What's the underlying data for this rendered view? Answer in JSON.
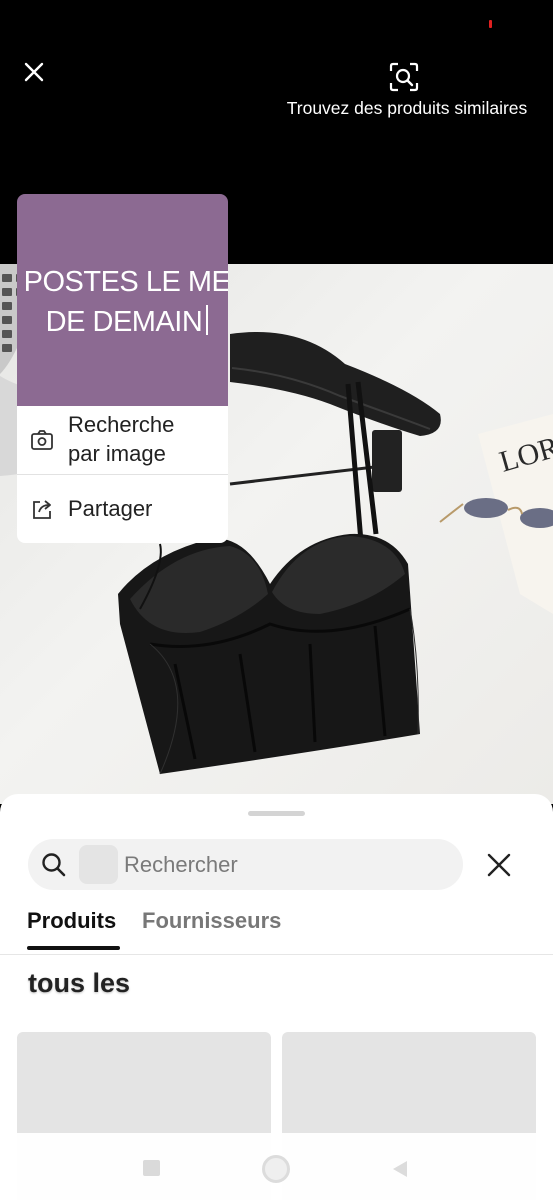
{
  "top_bar": {
    "close_icon": "close-icon",
    "similar_icon": "image-search-icon",
    "similar_label": "Trouvez des produits similaires"
  },
  "photo": {
    "description_icon": "product-photo",
    "book_text": "LOR"
  },
  "context_menu": {
    "preview_lines": [
      "POSTES LE ME",
      "DE DEMAIN"
    ],
    "preview_color": "#8c6a92",
    "items": [
      {
        "label_line1": "Recherche",
        "label_line2": "par image",
        "icon": "camera-icon"
      },
      {
        "label": "Partager",
        "icon": "share-icon"
      }
    ]
  },
  "sheet": {
    "search": {
      "placeholder": "Rechercher",
      "icon": "search-icon"
    },
    "close_icon": "close-icon",
    "tabs": [
      {
        "label": "Produits",
        "active": true
      },
      {
        "label": "Fournisseurs",
        "active": false
      }
    ],
    "section_title": "tous les"
  },
  "nav": {
    "recents_icon": "square-icon",
    "home_icon": "circle-icon",
    "back_icon": "triangle-back-icon"
  }
}
